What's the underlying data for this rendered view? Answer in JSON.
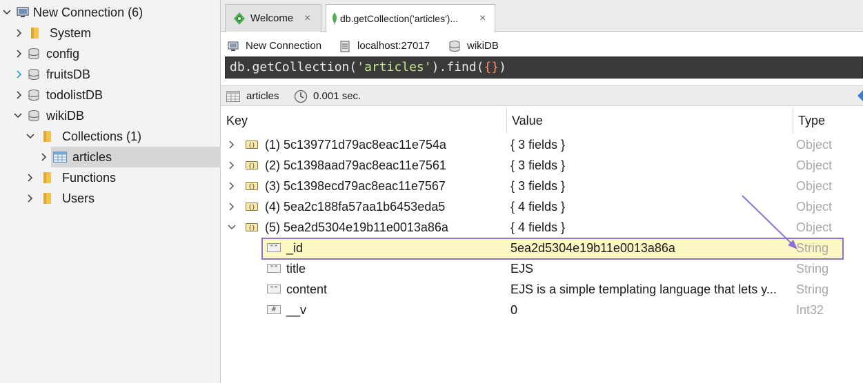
{
  "sidebar": {
    "connection": "New Connection (6)",
    "items": [
      {
        "label": "System"
      },
      {
        "label": "config"
      },
      {
        "label": "fruitsDB"
      },
      {
        "label": "todolistDB"
      },
      {
        "label": "wikiDB"
      },
      {
        "label": "Collections (1)"
      },
      {
        "label": "articles"
      },
      {
        "label": "Functions"
      },
      {
        "label": "Users"
      }
    ]
  },
  "tabs": [
    {
      "label": "Welcome",
      "close": "×"
    },
    {
      "label": "db.getCollection('articles')...",
      "close": "×"
    }
  ],
  "context": {
    "connection": "New Connection",
    "host": "localhost:27017",
    "database": "wikiDB"
  },
  "query": {
    "prefix": "db.getCollection(",
    "collection": "'articles'",
    "middle": ").find(",
    "braces": "{}",
    "suffix": ")"
  },
  "results": {
    "collection": "articles",
    "time": "0.001 sec."
  },
  "table": {
    "headers": {
      "key": "Key",
      "value": "Value",
      "type": "Type"
    },
    "rows": [
      {
        "key": "(1) 5c139771d79ac8eac11e754a",
        "value": "{ 3 fields }",
        "type": "Object"
      },
      {
        "key": "(2) 5c1398aad79ac8eac11e7561",
        "value": "{ 3 fields }",
        "type": "Object"
      },
      {
        "key": "(3) 5c1398ecd79ac8eac11e7567",
        "value": "{ 3 fields }",
        "type": "Object"
      },
      {
        "key": "(4) 5ea2c188fa57aa1b6453eda5",
        "value": "{ 4 fields }",
        "type": "Object"
      },
      {
        "key": "(5) 5ea2d5304e19b11e0013a86a",
        "value": "{ 4 fields }",
        "type": "Object"
      }
    ],
    "children": [
      {
        "key": "_id",
        "value": "5ea2d5304e19b11e0013a86a",
        "type": "String",
        "icon": "\"\""
      },
      {
        "key": "title",
        "value": "EJS",
        "type": "String",
        "icon": "\"\""
      },
      {
        "key": "content",
        "value": "EJS is a simple templating language that lets y...",
        "type": "String",
        "icon": "\"\""
      },
      {
        "key": "__v",
        "value": "0",
        "type": "Int32",
        "icon": "#"
      }
    ]
  },
  "colors": {
    "highlight_border": "#8e6fd8",
    "highlight_fill": "#fcf8c4",
    "selected_row": "#d6d6d6",
    "query_bg": "#3a3a3a",
    "mongo_green": "#4caf50"
  }
}
